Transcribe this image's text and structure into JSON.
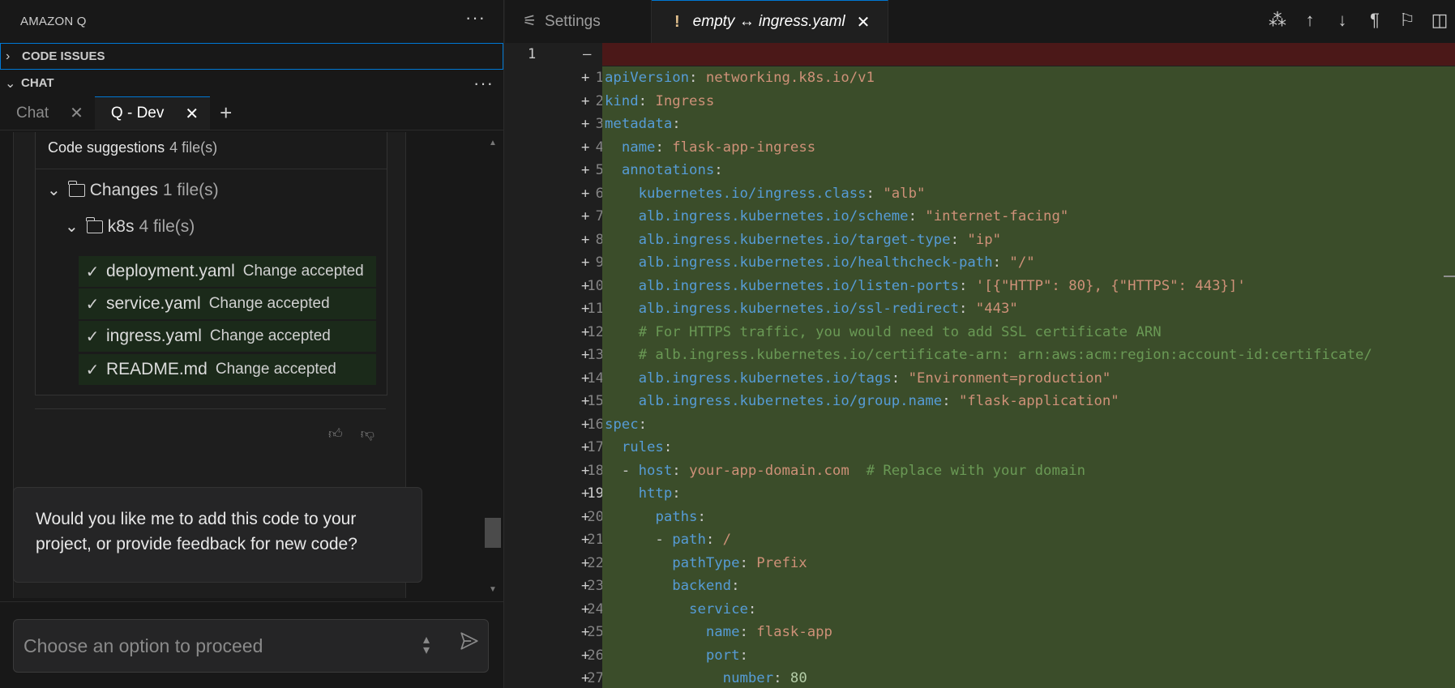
{
  "sidebar": {
    "title": "AMAZON Q",
    "more_icon": "more-horizontal-icon",
    "sections": {
      "code_issues": "CODE ISSUES",
      "chat": "CHAT"
    },
    "tabs": [
      {
        "label": "Chat"
      },
      {
        "label": "Q - Dev"
      }
    ],
    "suggestions": {
      "title": "Code suggestions",
      "count": "4 file(s)",
      "changes_label": "Changes",
      "changes_count": "1 file(s)",
      "folder_label": "k8s",
      "folder_count": "4 file(s)",
      "files": [
        {
          "name": "deployment.yaml",
          "status": "Change accepted"
        },
        {
          "name": "service.yaml",
          "status": "Change accepted"
        },
        {
          "name": "ingress.yaml",
          "status": "Change accepted"
        },
        {
          "name": "README.md",
          "status": "Change accepted"
        }
      ]
    },
    "question": "Would you like me to add this code to your project, or provide feedback for new code?",
    "prompt_placeholder": "Choose an option to proceed"
  },
  "editor": {
    "tabs": [
      {
        "label": "Settings"
      },
      {
        "label": "empty ↔ ingress.yaml",
        "badge": "!"
      }
    ],
    "original_line": "1",
    "current_line": 19
  },
  "colors": {
    "added_bg": "#3b4d2a",
    "deleted_bg": "#4b1818",
    "accent": "#0078d4"
  }
}
